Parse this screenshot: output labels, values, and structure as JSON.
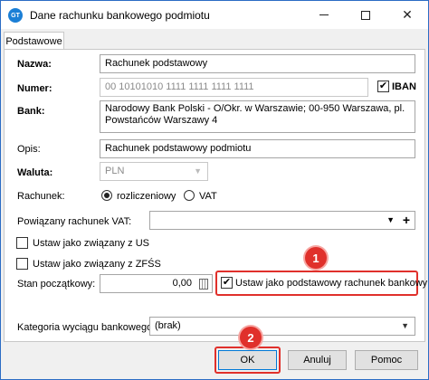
{
  "window": {
    "title": "Dane rachunku bankowego podmiotu",
    "app_icon_text": "GT"
  },
  "tabs": [
    "Podstawowe"
  ],
  "form": {
    "nazwa_label": "Nazwa:",
    "nazwa_value": "Rachunek podstawowy",
    "numer_label": "Numer:",
    "numer_value": "00 10101010 1111 1111 1111 1111",
    "iban_label": "IBAN",
    "iban_checked": true,
    "bank_label": "Bank:",
    "bank_value": "Narodowy Bank Polski  - O/Okr. w Warszawie; 00-950 Warszawa, pl. Powstańców Warszawy 4",
    "opis_label": "Opis:",
    "opis_value": "Rachunek podstawowy podmiotu",
    "waluta_label": "Waluta:",
    "waluta_value": "PLN",
    "rachunek_label": "Rachunek:",
    "rachunek_options": [
      "rozliczeniowy",
      "VAT"
    ],
    "rachunek_selected": "rozliczeniowy",
    "vat_account_label": "Powiązany rachunek VAT:",
    "vat_account_value": "",
    "ustaw_us_label": "Ustaw jako związany z US",
    "ustaw_us_checked": false,
    "ustaw_zfss_label": "Ustaw jako związany z ZFŚS",
    "ustaw_zfss_checked": false,
    "stan_label": "Stan początkowy:",
    "stan_value": "0,00",
    "ustaw_podstawowy_label": "Ustaw jako podstawowy rachunek bankowy",
    "ustaw_podstawowy_checked": true,
    "kategoria_label": "Kategoria wyciągu bankowego:",
    "kategoria_value": "(brak)"
  },
  "buttons": {
    "ok": "OK",
    "cancel": "Anuluj",
    "help": "Pomoc"
  },
  "annotations": {
    "badge1": "1",
    "badge2": "2",
    "color": "#e0302b"
  },
  "icons": {
    "check": "✔",
    "close": "✕",
    "dropdown": "▼",
    "plus": "+"
  }
}
